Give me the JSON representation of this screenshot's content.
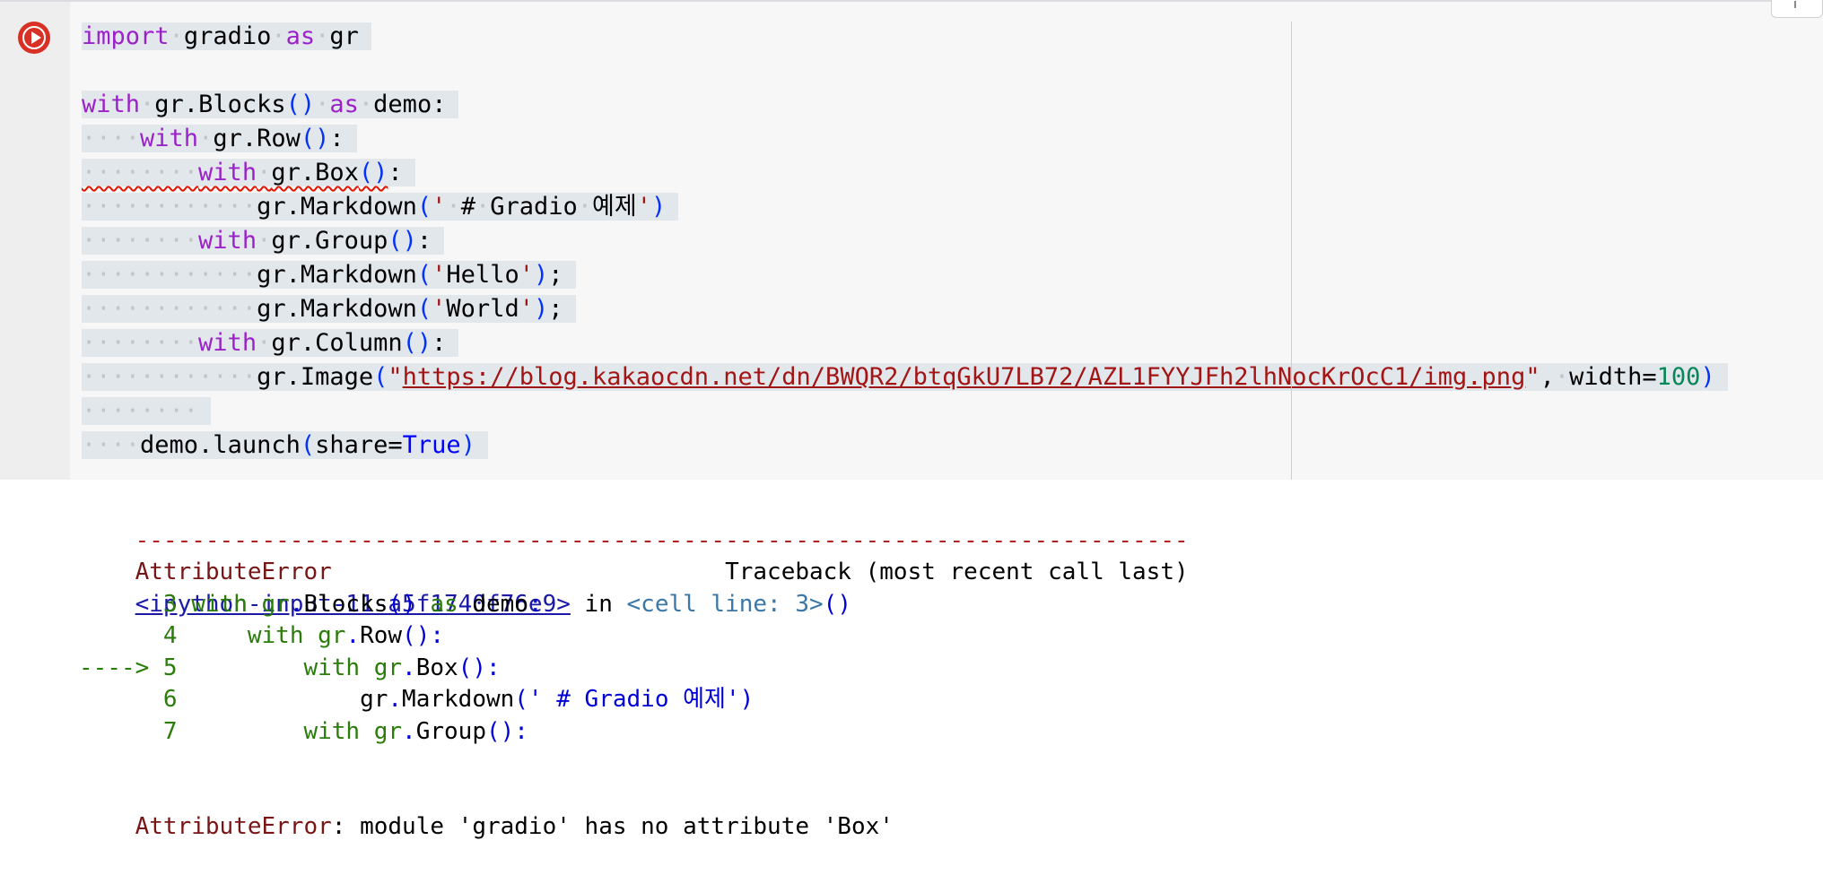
{
  "cell": {
    "run_button_label": "Run cell",
    "code_lines": [
      [
        {
          "t": "import",
          "c": "kw"
        },
        {
          "t": "·",
          "c": "ws"
        },
        {
          "t": "gradio"
        },
        {
          "t": "·",
          "c": "ws"
        },
        {
          "t": "as",
          "c": "kw"
        },
        {
          "t": "·",
          "c": "ws"
        },
        {
          "t": "gr"
        }
      ],
      [],
      [
        {
          "t": "with",
          "c": "kw"
        },
        {
          "t": "·",
          "c": "ws"
        },
        {
          "t": "gr.Blocks"
        },
        {
          "t": "()",
          "c": "br"
        },
        {
          "t": "·",
          "c": "ws"
        },
        {
          "t": "as",
          "c": "kw"
        },
        {
          "t": "·",
          "c": "ws"
        },
        {
          "t": "demo:"
        }
      ],
      [
        {
          "t": "····",
          "c": "ws"
        },
        {
          "t": "with",
          "c": "kw"
        },
        {
          "t": "·",
          "c": "ws"
        },
        {
          "t": "gr.Row"
        },
        {
          "t": "()",
          "c": "br"
        },
        {
          "t": ":"
        }
      ],
      [
        {
          "t": "········",
          "c": "ws"
        },
        {
          "t": "with",
          "c": "kw"
        },
        {
          "t": "·",
          "c": "ws"
        },
        {
          "t": "gr.Box"
        },
        {
          "t": "()",
          "c": "br"
        },
        {
          "t": ":"
        }
      ],
      [
        {
          "t": "············",
          "c": "ws"
        },
        {
          "t": "gr.Markdown"
        },
        {
          "t": "(",
          "c": "br"
        },
        {
          "t": "'",
          "c": "str"
        },
        {
          "t": "·",
          "c": "ws"
        },
        {
          "t": "#"
        },
        {
          "t": "·",
          "c": "ws"
        },
        {
          "t": "Gradio"
        },
        {
          "t": "·",
          "c": "ws"
        },
        {
          "t": "예제"
        },
        {
          "t": "'",
          "c": "str"
        },
        {
          "t": ")",
          "c": "br"
        }
      ],
      [
        {
          "t": "········",
          "c": "ws"
        },
        {
          "t": "with",
          "c": "kw"
        },
        {
          "t": "·",
          "c": "ws"
        },
        {
          "t": "gr.Group"
        },
        {
          "t": "()",
          "c": "br"
        },
        {
          "t": ":"
        }
      ],
      [
        {
          "t": "············",
          "c": "ws"
        },
        {
          "t": "gr.Markdown"
        },
        {
          "t": "(",
          "c": "br"
        },
        {
          "t": "'",
          "c": "str"
        },
        {
          "t": "Hello"
        },
        {
          "t": "'",
          "c": "str"
        },
        {
          "t": ")",
          "c": "br"
        },
        {
          "t": ";"
        }
      ],
      [
        {
          "t": "············",
          "c": "ws"
        },
        {
          "t": "gr.Markdown"
        },
        {
          "t": "(",
          "c": "br"
        },
        {
          "t": "'",
          "c": "str"
        },
        {
          "t": "World"
        },
        {
          "t": "'",
          "c": "str"
        },
        {
          "t": ")",
          "c": "br"
        },
        {
          "t": ";"
        }
      ],
      [
        {
          "t": "········",
          "c": "ws"
        },
        {
          "t": "with",
          "c": "kw"
        },
        {
          "t": "·",
          "c": "ws"
        },
        {
          "t": "gr.Column"
        },
        {
          "t": "()",
          "c": "br"
        },
        {
          "t": ":"
        }
      ],
      [
        {
          "t": "············",
          "c": "ws"
        },
        {
          "t": "gr.Image"
        },
        {
          "t": "(",
          "c": "br"
        },
        {
          "t": "\"",
          "c": "str"
        },
        {
          "t": "https://blog.kakaocdn.net/dn/BWQR2/btqGkU7LB72/AZL1FYYJFh2lhNocKrOcC1/img.png",
          "c": "str url"
        },
        {
          "t": "\"",
          "c": "str"
        },
        {
          "t": ","
        },
        {
          "t": "·",
          "c": "ws"
        },
        {
          "t": "width="
        },
        {
          "t": "100",
          "c": "num"
        },
        {
          "t": ")",
          "c": "br"
        }
      ],
      [
        {
          "t": "········",
          "c": "ws"
        }
      ],
      [
        {
          "t": "····",
          "c": "ws"
        },
        {
          "t": "demo.launch"
        },
        {
          "t": "(",
          "c": "br"
        },
        {
          "t": "share="
        },
        {
          "t": "True",
          "c": "const"
        },
        {
          "t": ")",
          "c": "br"
        }
      ]
    ]
  },
  "output": {
    "separator": "---------------------------------------------------------------------------",
    "error_name": "AttributeError",
    "traceback_label": "Traceback (most recent call last)",
    "input_link": "<ipython-input-11-a5f1740f76e9>",
    "in_text": "in",
    "cell_line": "<cell line: 3>",
    "cell_line_parens": "()",
    "frames": [
      {
        "marker": "      ",
        "lineno": "3",
        "indent": " ",
        "text": [
          {
            "t": "with gr",
            "c": "o-green"
          },
          {
            "t": ".",
            "c": "o-blue"
          },
          {
            "t": "Blocks",
            "c": ""
          },
          {
            "t": "()",
            "c": "o-blue"
          },
          {
            "t": " as",
            "c": "o-green"
          },
          {
            "t": " demo",
            "c": ""
          },
          {
            "t": ":",
            "c": "o-blue"
          }
        ]
      },
      {
        "marker": "      ",
        "lineno": "4",
        "indent": "     ",
        "text": [
          {
            "t": "with gr",
            "c": "o-green"
          },
          {
            "t": ".",
            "c": "o-blue"
          },
          {
            "t": "Row",
            "c": ""
          },
          {
            "t": "():",
            "c": "o-blue"
          }
        ]
      },
      {
        "marker": "----> ",
        "lineno": "5",
        "indent": "         ",
        "text": [
          {
            "t": "with gr",
            "c": "o-green"
          },
          {
            "t": ".",
            "c": "o-blue"
          },
          {
            "t": "Box",
            "c": ""
          },
          {
            "t": "():",
            "c": "o-blue"
          }
        ]
      },
      {
        "marker": "      ",
        "lineno": "6",
        "indent": "             ",
        "text": [
          {
            "t": "gr",
            "c": ""
          },
          {
            "t": ".",
            "c": "o-blue"
          },
          {
            "t": "Markdown",
            "c": ""
          },
          {
            "t": "(' # Gradio 예제')",
            "c": "o-blue"
          }
        ]
      },
      {
        "marker": "      ",
        "lineno": "7",
        "indent": "         ",
        "text": [
          {
            "t": "with gr",
            "c": "o-green"
          },
          {
            "t": ".",
            "c": "o-blue"
          },
          {
            "t": "Group",
            "c": ""
          },
          {
            "t": "():",
            "c": "o-blue"
          }
        ]
      }
    ],
    "final_error_name": "AttributeError",
    "final_error_message": ": module 'gradio' has no attribute 'Box'"
  }
}
